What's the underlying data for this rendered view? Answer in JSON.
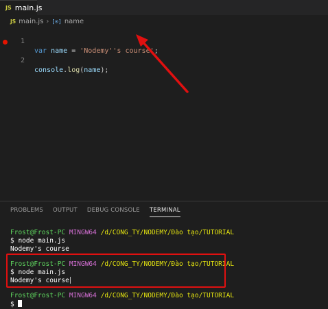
{
  "tab": {
    "badge": "JS",
    "label": "main.js"
  },
  "breadcrumb": {
    "badge": "JS",
    "file": "main.js",
    "symbol_icon": "[⊙]",
    "symbol": "name"
  },
  "editor": {
    "lines": [
      {
        "num": "1",
        "tokens": [
          "var",
          " ",
          "name",
          " = ",
          "'Nodemy''s course'",
          ";"
        ]
      },
      {
        "num": "2",
        "tokens": [
          "console",
          ".",
          "log",
          "(",
          "name",
          ");"
        ]
      }
    ]
  },
  "panel": {
    "tabs": [
      "PROBLEMS",
      "OUTPUT",
      "DEBUG CONSOLE",
      "TERMINAL"
    ],
    "active": "TERMINAL"
  },
  "terminal": {
    "prompt_user": "Frost@Frost-PC",
    "prompt_host": "MINGW64",
    "prompt_path": "/d/CONG_TY/NODEMY/Đào tạo/TUTORIAL",
    "command": "$ node main.js",
    "output": "Nodemy's course",
    "cursor_prompt": "$ "
  },
  "colors": {
    "highlight": "#e01010",
    "breakpoint": "#e51400"
  }
}
